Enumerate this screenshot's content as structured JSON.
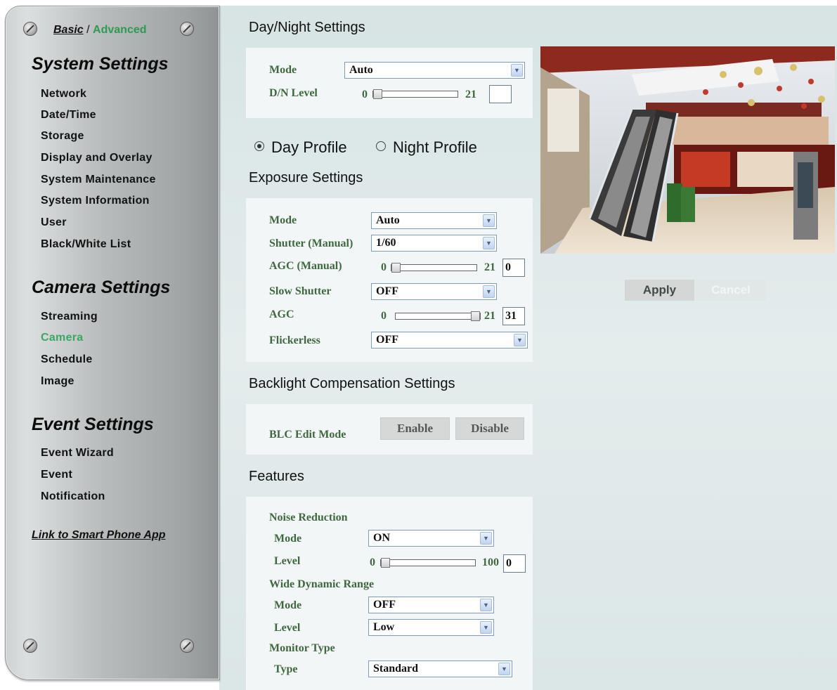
{
  "sidebar": {
    "mode_basic": "Basic",
    "mode_sep": " / ",
    "mode_advanced": "Advanced",
    "system_settings": {
      "heading": "System Settings",
      "items": [
        "Network",
        "Date/Time",
        "Storage",
        "Display and Overlay",
        "System Maintenance",
        "System Information",
        "User",
        "Black/White List"
      ]
    },
    "camera_settings": {
      "heading": "Camera Settings",
      "items": [
        "Streaming",
        "Camera",
        "Schedule",
        "Image"
      ],
      "active": "Camera"
    },
    "event_settings": {
      "heading": "Event Settings",
      "items": [
        "Event Wizard",
        "Event",
        "Notification"
      ]
    },
    "smart_phone_link": "Link to Smart Phone App"
  },
  "day_night": {
    "title": "Day/Night Settings",
    "mode_label": "Mode",
    "mode_value": "Auto",
    "level_label": "D/N Level",
    "level_min": "0",
    "level_max": "21",
    "level_value": ""
  },
  "profiles": {
    "day": "Day Profile",
    "night": "Night Profile",
    "selected": "day"
  },
  "exposure": {
    "title": "Exposure Settings",
    "mode_label": "Mode",
    "mode_value": "Auto",
    "shutter_label": "Shutter (Manual)",
    "shutter_value": "1/60",
    "agc_manual_label": "AGC (Manual)",
    "agc_manual_min": "0",
    "agc_manual_max": "21",
    "agc_manual_value": "0",
    "slow_shutter_label": "Slow Shutter",
    "slow_shutter_value": "OFF",
    "agc_label": "AGC",
    "agc_min": "0",
    "agc_max": "21",
    "agc_value": "31",
    "flickerless_label": "Flickerless",
    "flickerless_value": "OFF"
  },
  "backlight": {
    "title": "Backlight Compensation Settings",
    "edit_label": "BLC Edit Mode",
    "enable_label": "Enable",
    "disable_label": "Disable"
  },
  "features": {
    "title": "Features",
    "nr_heading": "Noise Reduction",
    "nr_mode_label": "Mode",
    "nr_mode_value": "ON",
    "nr_level_label": "Level",
    "nr_level_min": "0",
    "nr_level_max": "100",
    "nr_level_value": "0",
    "wdr_heading": "Wide Dynamic Range",
    "wdr_mode_label": "Mode",
    "wdr_mode_value": "OFF",
    "wdr_level_label": "Level",
    "wdr_level_value": "Low",
    "monitor_heading": "Monitor Type",
    "monitor_type_label": "Type",
    "monitor_type_value": "Standard"
  },
  "actions": {
    "apply": "Apply",
    "cancel": "Cancel"
  },
  "icons": {
    "screw": "screw-icon",
    "dropdown": "chevron-down-icon",
    "radio": "radio-icon"
  },
  "colors": {
    "accent_green": "#3aa862",
    "label_green": "#3f6840",
    "panel_bg": "#f3f6f6",
    "main_bg": "#dce7e7"
  }
}
